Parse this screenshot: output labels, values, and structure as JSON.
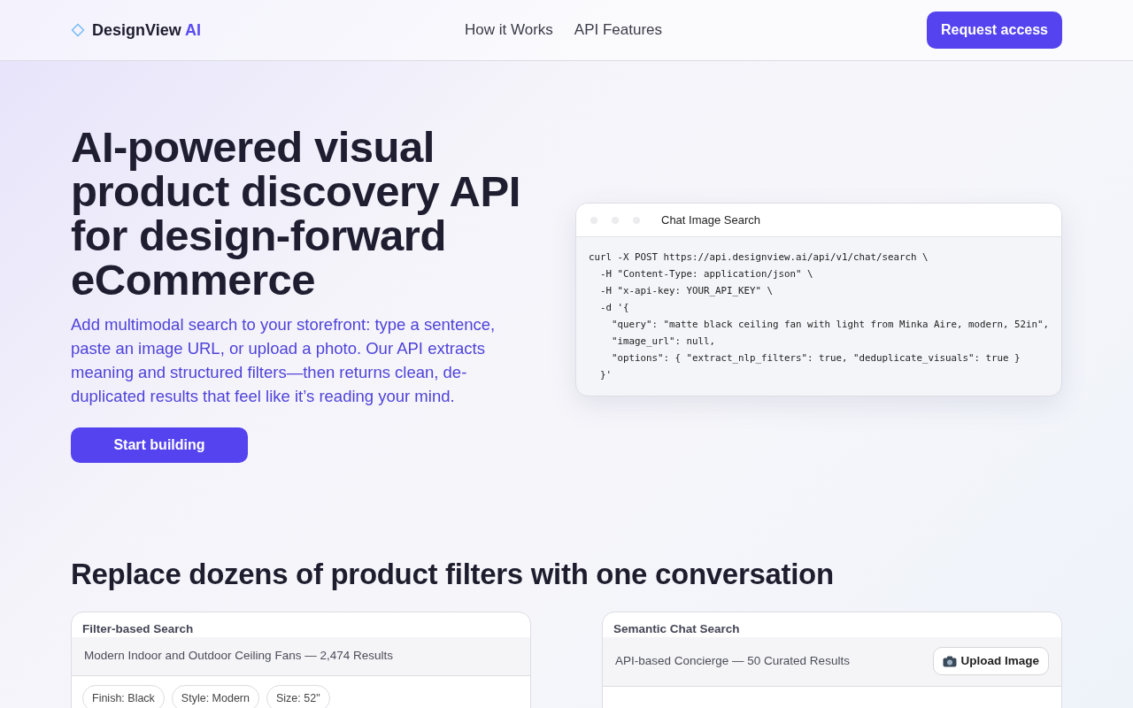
{
  "nav": {
    "brand": "DesignView",
    "brand_accent": "AI",
    "links": [
      "How it Works",
      "API Features"
    ],
    "cta": "Request access"
  },
  "hero": {
    "title": "AI-powered visual product discovery API for design-forward eCommerce",
    "lead": "Add multimodal search to your storefront: type a sentence, paste an image URL, or upload a photo. Our API extracts meaning and structured filters—then returns clean, de-duplicated results that feel like it’s reading your mind.",
    "button": "Start building"
  },
  "code_window": {
    "title": "Chat Image Search",
    "lines": [
      "curl -X POST https://api.designview.ai/api/v1/chat/search \\",
      "  -H \"Content-Type: application/json\" \\",
      "  -H \"x-api-key: YOUR_API_KEY\" \\",
      "  -d '{",
      "    \"query\": \"matte black ceiling fan with light from Minka Aire, modern, 52in\",",
      "    \"image_url\": null,",
      "    \"options\": { \"extract_nlp_filters\": true, \"deduplicate_visuals\": true }",
      "  }'"
    ]
  },
  "comparison": {
    "heading": "Replace dozens of product filters with one conversation",
    "cards": [
      {
        "kind": "filters",
        "title": "Filter-based Search",
        "subtitle": "Modern Indoor and Outdoor Ceiling Fans — 2,474 Results",
        "chips": [
          "Finish: Black",
          "Style: Modern",
          "Size: 52\""
        ]
      },
      {
        "kind": "chat",
        "title": "Semantic Chat Search",
        "subtitle": "API-based Concierge — 50 Curated Results",
        "button": "Upload Image"
      }
    ]
  }
}
